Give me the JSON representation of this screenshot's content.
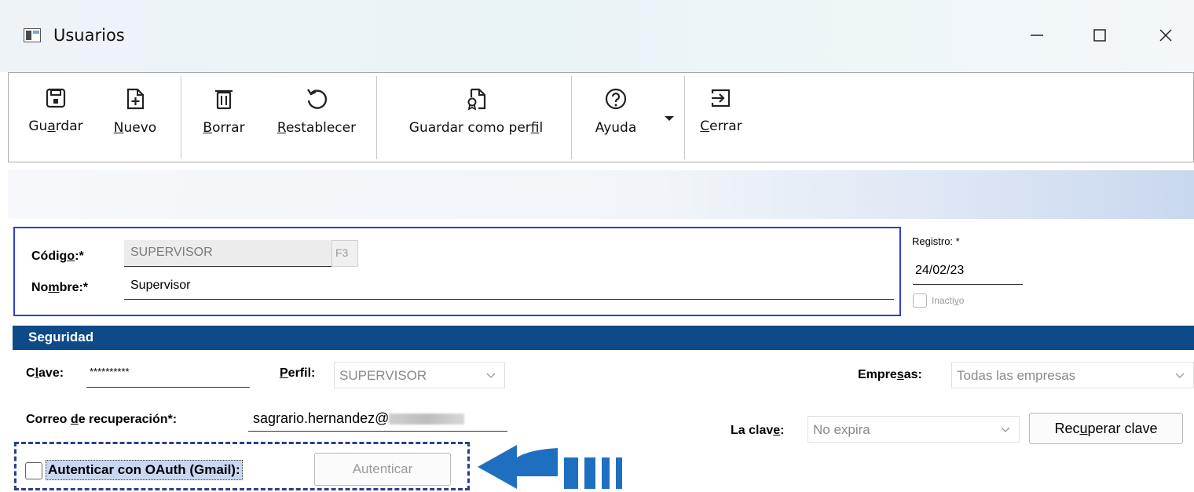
{
  "window": {
    "title": "Usuarios"
  },
  "toolbar": {
    "guardar": {
      "pre": "Gu",
      "key": "a",
      "post": "rdar"
    },
    "nuevo": {
      "pre": "",
      "key": "N",
      "post": "uevo"
    },
    "borrar": {
      "pre": "",
      "key": "B",
      "post": "orrar"
    },
    "restablecer": {
      "pre": "",
      "key": "R",
      "post": "establecer"
    },
    "guardar_perfil": {
      "pre": "Guardar como per",
      "key": "f",
      "post": "il"
    },
    "ayuda": {
      "pre": "Ayuda",
      "key": "",
      "post": ""
    },
    "cerrar": {
      "pre": "",
      "key": "C",
      "post": "errar"
    }
  },
  "header": {
    "codigo": {
      "pre": "Códig",
      "key": "o",
      "post": ":*",
      "value": "SUPERVISOR",
      "lookup": "F3"
    },
    "nombre": {
      "pre": "No",
      "key": "m",
      "post": "bre:*",
      "value": "Supervisor"
    },
    "registro": {
      "pre": "Re",
      "key": "g",
      "post": "istro: *",
      "value": "24/02/23"
    },
    "inactivo": {
      "pre": "Inacti",
      "key": "v",
      "post": "o",
      "checked": false
    }
  },
  "seguridad": {
    "title": "Seguridad",
    "clave": {
      "pre": "C",
      "key": "l",
      "post": "ave:",
      "value": "**********"
    },
    "perfil": {
      "pre": "",
      "key": "P",
      "post": "erfil:",
      "value": "SUPERVISOR"
    },
    "empresas": {
      "pre": "Empre",
      "key": "s",
      "post": "as:",
      "value": "Todas las empresas"
    },
    "correo": {
      "pre": "Correo ",
      "key": "d",
      "post": "e recuperación*:",
      "value": "sagrario.hernandez@"
    },
    "la_clave": {
      "pre": "La clav",
      "key": "e",
      "post": ":",
      "value": "No expira"
    },
    "recuperar": {
      "pre": "Rec",
      "key": "u",
      "post": "perar clave"
    },
    "oauth": {
      "label": "Autenticar con OAuth (Gmail):",
      "checked": false
    },
    "autenticar": {
      "label": "Autenticar"
    }
  },
  "colors": {
    "section_bar": "#0f4a88",
    "focus_border": "#2d3fcc",
    "annotation_arrow": "#1f6fc1",
    "annotation_dash": "#2a3f8f"
  }
}
